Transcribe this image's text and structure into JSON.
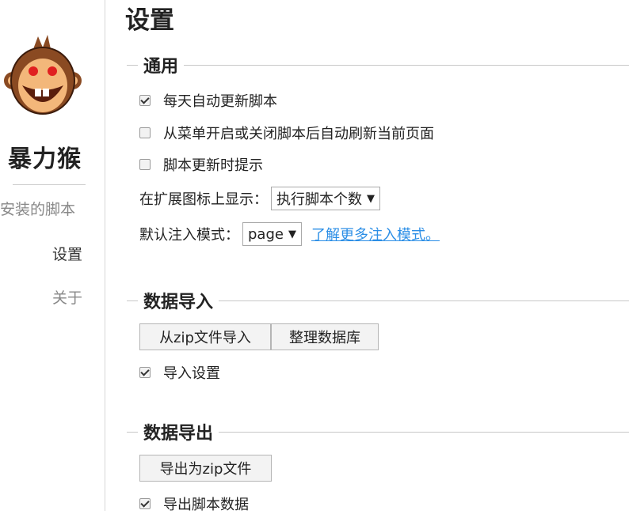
{
  "sidebar": {
    "brand": "暴力猴",
    "items": [
      {
        "label": "安装的脚本"
      },
      {
        "label": "设置"
      },
      {
        "label": "关于"
      }
    ]
  },
  "main": {
    "title": "设置",
    "general": {
      "heading": "通用",
      "auto_update_label": "每天自动更新脚本",
      "auto_update_checked": true,
      "auto_refresh_label": "从菜单开启或关闭脚本后自动刷新当前页面",
      "auto_refresh_checked": false,
      "notify_update_label": "脚本更新时提示",
      "notify_update_checked": false,
      "badge_label": "在扩展图标上显示：",
      "badge_value": "执行脚本个数",
      "inject_label": "默认注入模式：",
      "inject_value": "page",
      "inject_link": "了解更多注入模式。"
    },
    "import": {
      "heading": "数据导入",
      "zip_import_button": "从zip文件导入",
      "vacuum_button": "整理数据库",
      "import_settings_label": "导入设置",
      "import_settings_checked": true
    },
    "export": {
      "heading": "数据导出",
      "zip_export_button": "导出为zip文件",
      "export_data_label": "导出脚本数据",
      "export_data_checked": true
    }
  },
  "icons": {
    "logo": "monkey-face-icon",
    "caret": "dropdown-caret-icon"
  },
  "colors": {
    "link": "#2b8ee6",
    "logo_fur": "#8a4a22",
    "logo_face": "#f3b77a",
    "logo_eyes": "#e02020"
  }
}
